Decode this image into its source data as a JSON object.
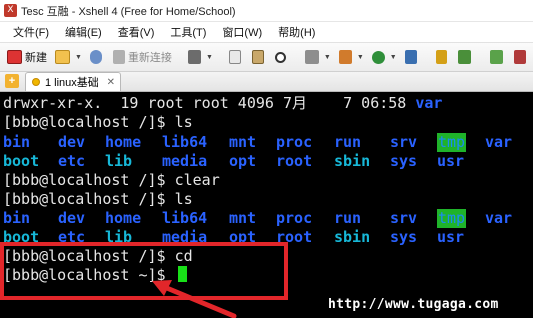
{
  "window": {
    "title": "Tesc 互融 - Xshell 4 (Free for Home/School)"
  },
  "menu": [
    "文件(F)",
    "编辑(E)",
    "查看(V)",
    "工具(T)",
    "窗口(W)",
    "帮助(H)"
  ],
  "toolbar": {
    "new_label": "新建",
    "reconnect_label": "重新连接"
  },
  "tabs": [
    {
      "label": "1 linux基础"
    }
  ],
  "terminal": {
    "lines": {
      "l0_perm": "drwxr-xr-x.  19 root root 4096 7月    7 06:58 ",
      "l0_name": "var",
      "l1": "[bbb@localhost /]$ ls",
      "l3": "[bbb@localhost /]$ clear",
      "l4": "[bbb@localhost /]$ ls",
      "l6": "[bbb@localhost /]$ cd",
      "l7": "[bbb@localhost ~]$ "
    },
    "ls_row1": [
      "bin",
      "dev",
      "home",
      "lib64",
      "mnt",
      "proc",
      "run",
      "srv",
      "tmp",
      "var"
    ],
    "ls_row2": [
      "boot",
      "etc",
      "lib",
      "media",
      "opt",
      "root",
      "sbin",
      "sys",
      "usr"
    ],
    "colors": {
      "directory": "#2a62ff",
      "symlink": "#17b8d8",
      "sticky_bg": "#1fb32a",
      "cursor": "#18e018",
      "annotation": "#e2262a"
    }
  },
  "watermark": "http://www.tugaga.com"
}
